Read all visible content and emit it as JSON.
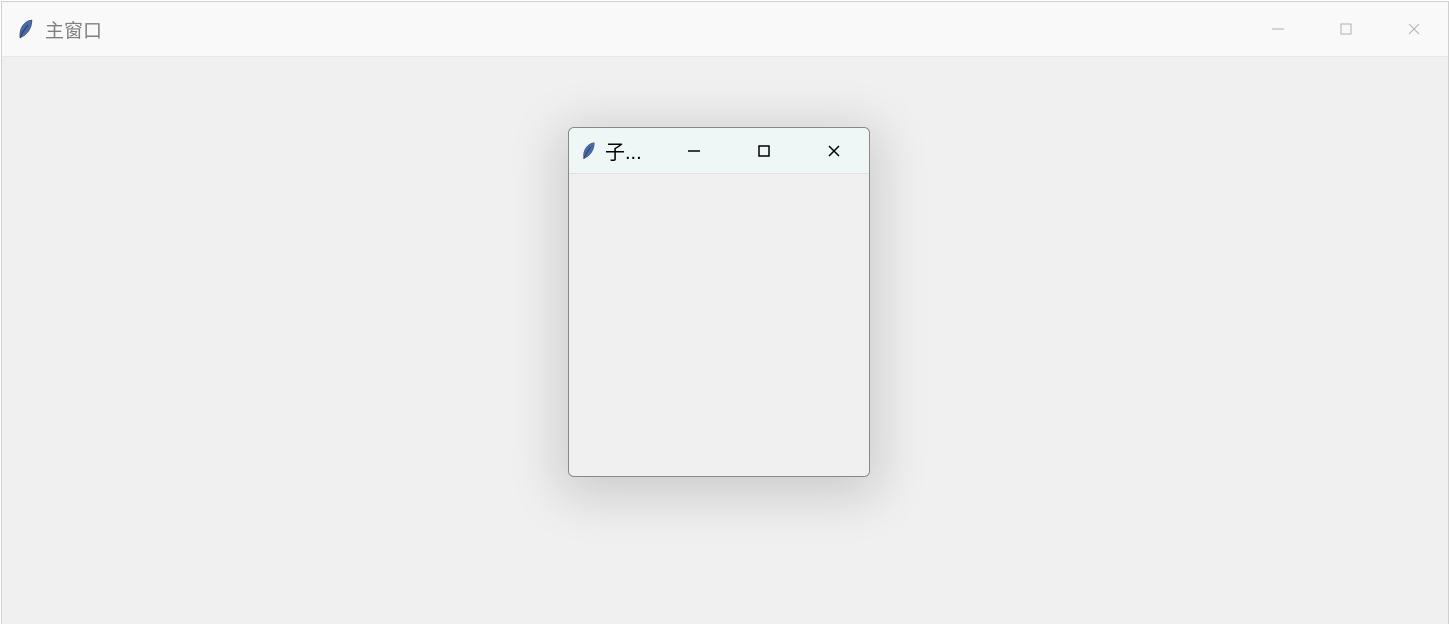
{
  "main_window": {
    "title": "主窗口"
  },
  "child_window": {
    "title": "子..."
  }
}
